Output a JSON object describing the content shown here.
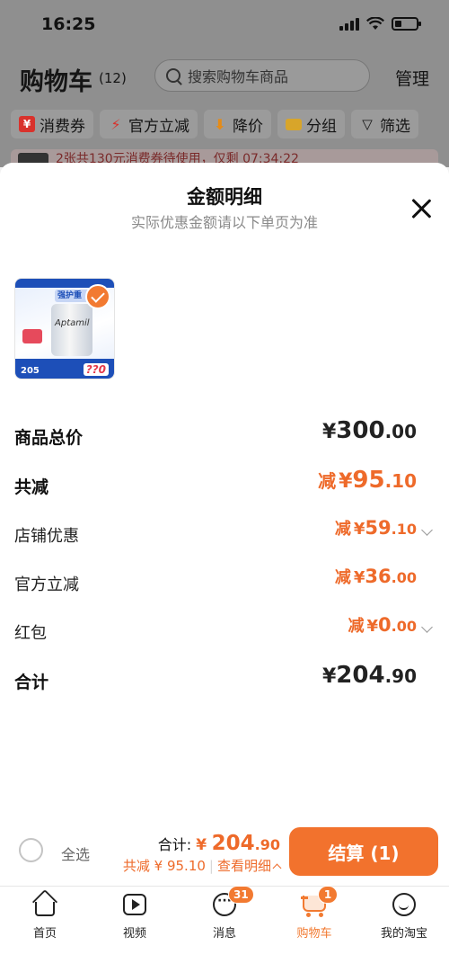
{
  "status_bar": {
    "time": "16:25"
  },
  "background_page": {
    "title": "购物车",
    "count": "(12)",
    "search_placeholder": "搜索购物车商品",
    "manage_label": "管理",
    "filters": [
      {
        "label": "消费券",
        "icon": "coupon-icon",
        "color": "#d9322c"
      },
      {
        "label": "官方立减",
        "icon": "lightning-icon",
        "color": "#d9322c"
      },
      {
        "label": "降价",
        "icon": "price-down-icon",
        "color": "#e48b18"
      },
      {
        "label": "分组",
        "icon": "folder-icon",
        "color": "#d8a52a"
      },
      {
        "label": "筛选",
        "icon": "filter-icon",
        "color": "#151515"
      }
    ],
    "promo_text": "2张共130元消费券待使用，仅剩 07:34:22"
  },
  "sheet": {
    "title": "金额明细",
    "subtitle": "实际优惠金额请以下单页为准",
    "product_image": {
      "banner_text": "强护重",
      "brand": "Aptamil",
      "price_tag": "205",
      "price_hidden": "??0"
    },
    "rows": [
      {
        "label": "商品总价",
        "prefix": "",
        "currency": "¥",
        "int": "300",
        "dec": ".00",
        "style": "total",
        "arrow": false
      },
      {
        "label": "共减",
        "prefix": "减",
        "currency": "¥",
        "int": "95",
        "dec": ".10",
        "style": "highlight",
        "arrow": false
      },
      {
        "label": "店铺优惠",
        "prefix": "减",
        "currency": "¥",
        "int": "59",
        "dec": ".10",
        "style": "sub",
        "arrow": true
      },
      {
        "label": "官方立减",
        "prefix": "减",
        "currency": "¥",
        "int": "36",
        "dec": ".00",
        "style": "sub",
        "arrow": false
      },
      {
        "label": "红包",
        "prefix": "减",
        "currency": "¥",
        "int": "0",
        "dec": ".00",
        "style": "sub",
        "arrow": true
      },
      {
        "label": "合计",
        "prefix": "",
        "currency": "¥",
        "int": "204",
        "dec": ".90",
        "style": "total",
        "arrow": false
      }
    ]
  },
  "checkout": {
    "select_all_label": "全选",
    "total_label": "合计:",
    "total_currency": "¥",
    "total_int": "204",
    "total_dec": ".90",
    "discount_text": "共减 ¥ 95.10",
    "detail_link": "查看明细",
    "button_label": "结算 (1)",
    "accent_color": "#f2722d"
  },
  "tabbar": {
    "items": [
      {
        "label": "首页",
        "icon": "home-icon"
      },
      {
        "label": "视频",
        "icon": "video-play-icon"
      },
      {
        "label": "消息",
        "icon": "message-icon",
        "badge": "31"
      },
      {
        "label": "购物车",
        "icon": "cart-icon",
        "badge": "1",
        "active": true
      },
      {
        "label": "我的淘宝",
        "icon": "profile-icon"
      }
    ]
  }
}
